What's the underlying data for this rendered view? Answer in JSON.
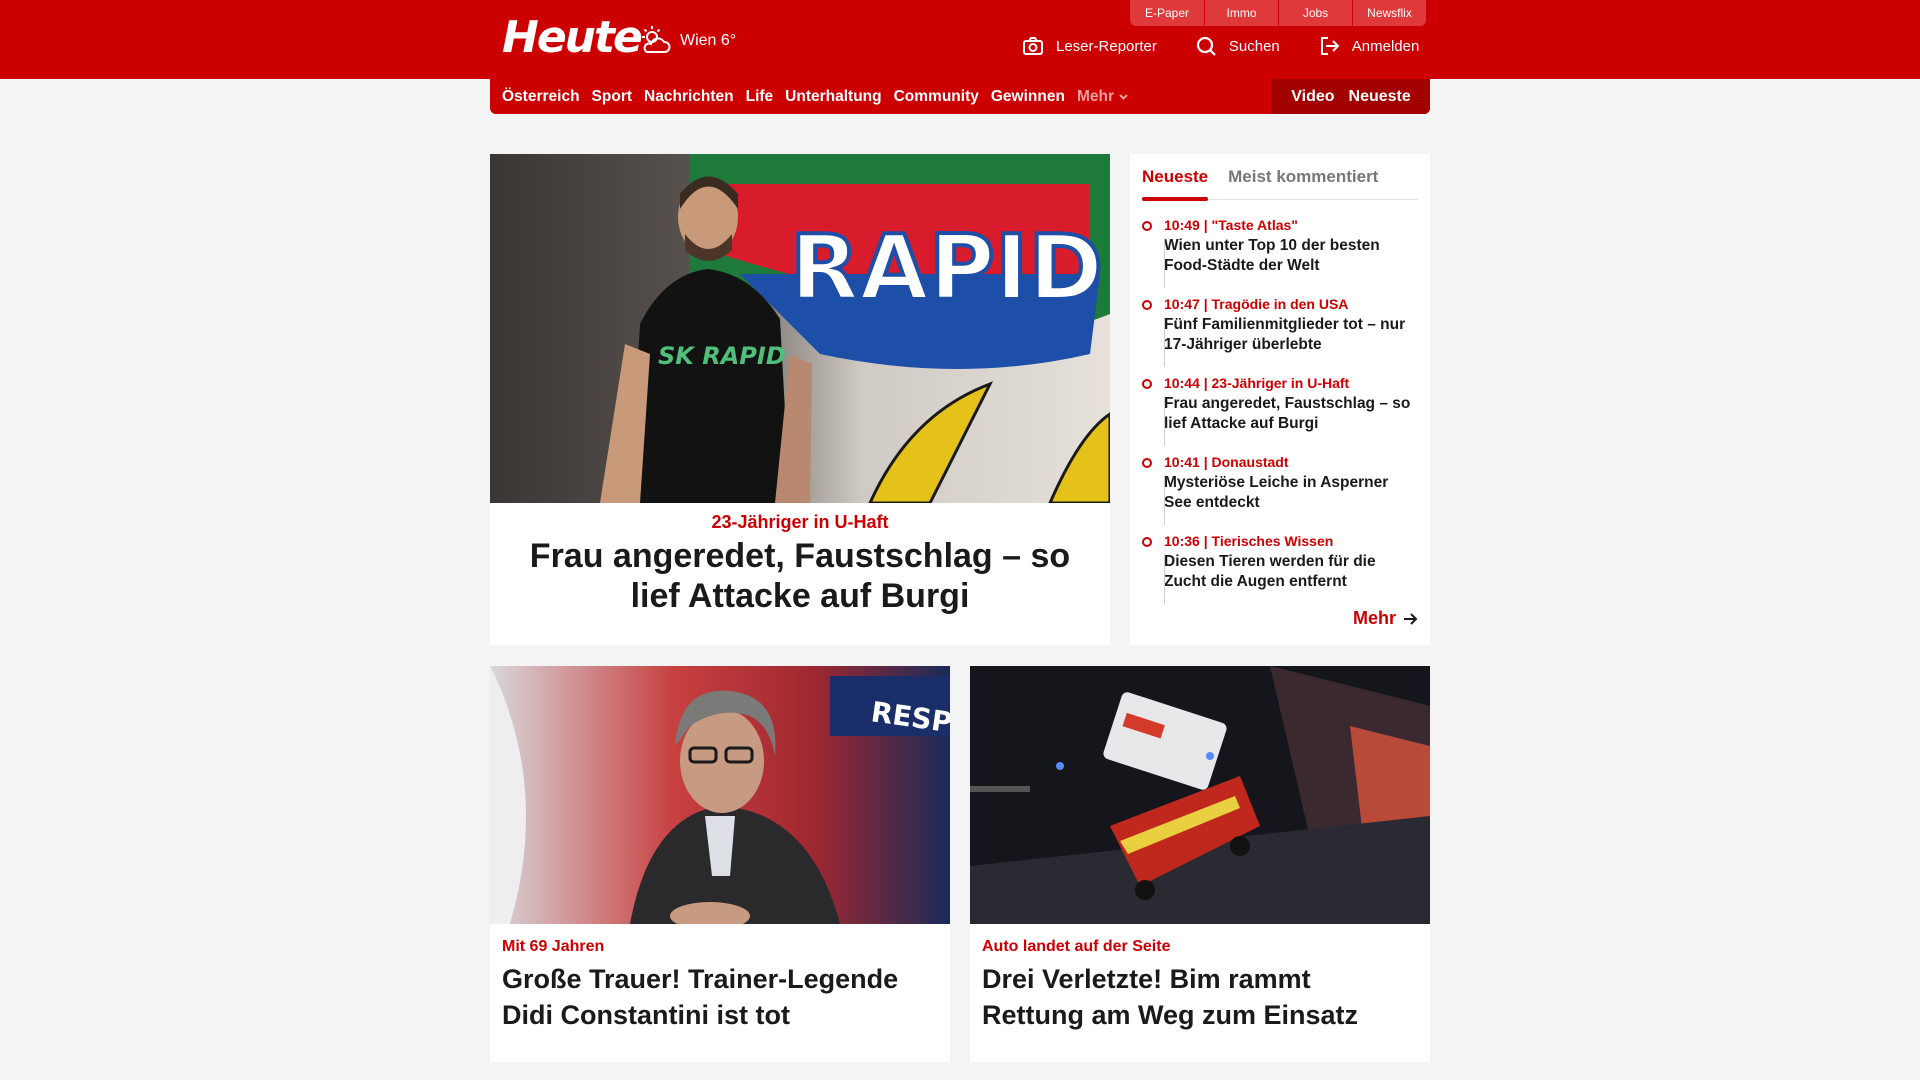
{
  "header": {
    "logo": "Heute",
    "weather": "Wien 6°",
    "service_tabs": [
      "E-Paper",
      "Immo",
      "Jobs",
      "Newsflix"
    ],
    "actions": [
      {
        "label": "Leser-Reporter",
        "icon": "camera-icon"
      },
      {
        "label": "Suchen",
        "icon": "search-icon"
      },
      {
        "label": "Anmelden",
        "icon": "login-icon"
      }
    ]
  },
  "nav": {
    "items": [
      "Österreich",
      "Sport",
      "Nachrichten",
      "Life",
      "Unterhaltung",
      "Community",
      "Gewinnen"
    ],
    "more": "Mehr",
    "right": [
      "Video",
      "Neueste"
    ]
  },
  "hero": {
    "kicker": "23-Jähriger in U-Haft",
    "title": "Frau angeredet, Faustschlag – so lief Attacke auf Burgi",
    "image_text": {
      "shirt": "SK RAPID",
      "banner": "RAPID"
    }
  },
  "sidebar": {
    "tabs": [
      "Neueste",
      "Meist kommentiert"
    ],
    "items": [
      {
        "time": "10:49",
        "topic": "\"Taste Atlas\"",
        "title": "Wien unter Top 10 der besten Food-Städte der Welt"
      },
      {
        "time": "10:47",
        "topic": "Tragödie in den USA",
        "title": "Fünf Familienmitglieder tot – nur 17-Jähriger überlebte"
      },
      {
        "time": "10:44",
        "topic": "23-Jähriger in U-Haft",
        "title": "Frau angeredet, Faustschlag – so lief Attacke auf Burgi"
      },
      {
        "time": "10:41",
        "topic": "Donaustadt",
        "title": "Mysteriöse Leiche in Asperner See entdeckt"
      },
      {
        "time": "10:36",
        "topic": "Tierisches Wissen",
        "title": "Diesen Tieren werden für die Zucht die Augen entfernt"
      }
    ],
    "more": "Mehr"
  },
  "cards": [
    {
      "kicker": "Mit 69 Jahren",
      "title": "Große Trauer! Trainer-Legende Didi Constantini ist tot",
      "image_text": "RESPECT"
    },
    {
      "kicker": "Auto landet auf der Seite",
      "title": "Drei Verletzte! Bim rammt Rettung am Weg zum Einsatz"
    }
  ],
  "colors": {
    "brand": "#cc0000",
    "brand_dark": "#a30000",
    "background": "#f4f4f4"
  }
}
